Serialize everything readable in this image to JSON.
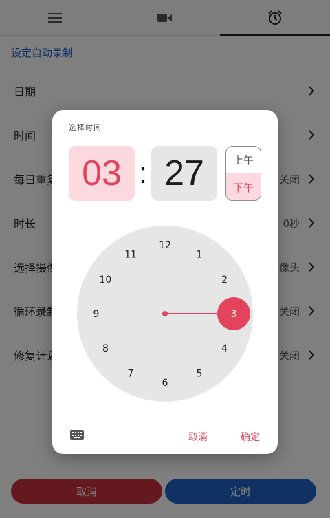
{
  "tabs": [
    {
      "icon": "menu-icon"
    },
    {
      "icon": "video-camera-icon"
    },
    {
      "icon": "alarm-clock-icon",
      "active": true
    }
  ],
  "section_title": "设定自动录制",
  "rows": [
    {
      "label": "日期",
      "value": ""
    },
    {
      "label": "时间",
      "value": ""
    },
    {
      "label": "每日重复",
      "value": "关闭"
    },
    {
      "label": "时长",
      "value": "0秒"
    },
    {
      "label": "选择摄像头",
      "value": "像头"
    },
    {
      "label": "循环录制",
      "value": "关闭"
    },
    {
      "label": "修复计划",
      "value": "关闭"
    }
  ],
  "bottom": {
    "cancel": "取消",
    "confirm": "定时"
  },
  "dialog": {
    "title": "选择时间",
    "hour": "03",
    "colon": ":",
    "minute": "27",
    "am": "上午",
    "pm": "下午",
    "selected_period": "pm",
    "selected_hour": 3,
    "dial_numbers": [
      "12",
      "1",
      "2",
      "3",
      "4",
      "5",
      "6",
      "7",
      "8",
      "9",
      "10",
      "11"
    ],
    "cancel": "取消",
    "ok": "确定"
  },
  "colors": {
    "accent": "#e3445c",
    "accent_light": "#fbd9de",
    "blue": "#1e5fc7",
    "cancel_btn": "#c8323e",
    "confirm_btn": "#1e63c8"
  }
}
